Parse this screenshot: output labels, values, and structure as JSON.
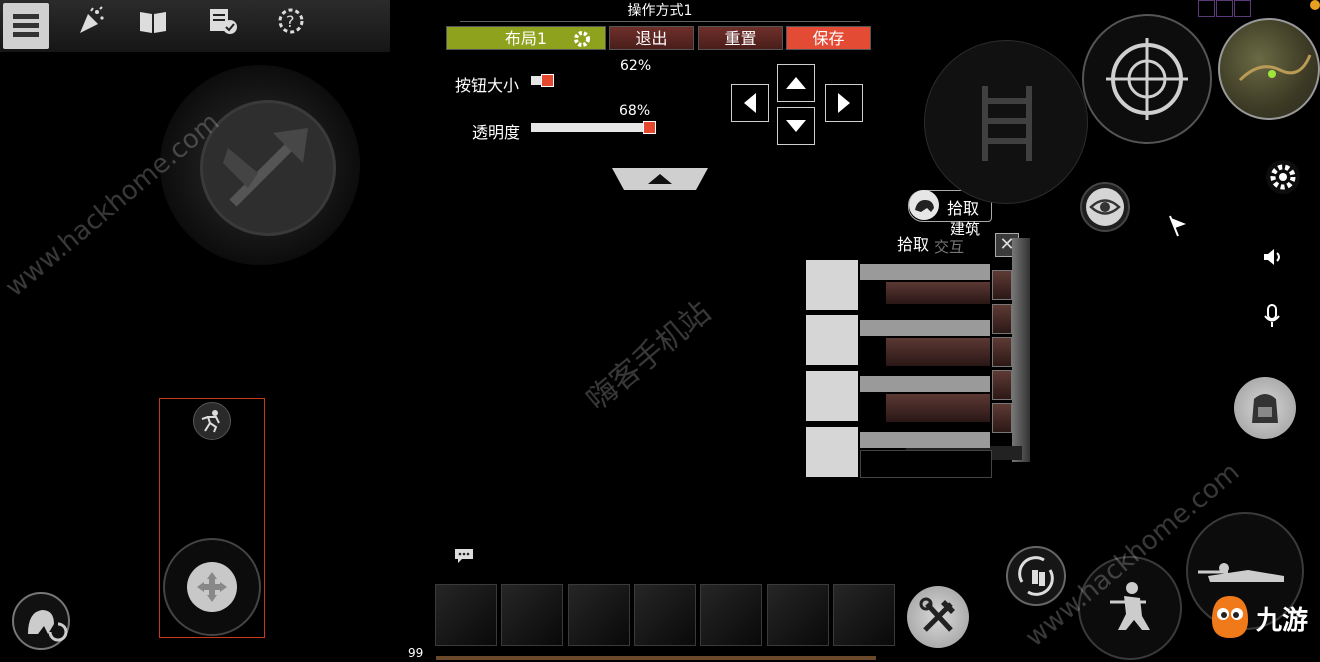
{
  "toolbar": {
    "icons": [
      "menu-icon",
      "party-popper-icon",
      "book-icon",
      "checklist-icon",
      "help-gear-icon"
    ]
  },
  "layout_editor": {
    "title": "操作方式1",
    "layout_label": "布局1",
    "exit_label": "退出",
    "reset_label": "重置",
    "save_label": "保存",
    "button_size_label": "按钮大小",
    "button_size_value": "62%",
    "button_size_fraction": 0.62,
    "opacity_label": "透明度",
    "opacity_value": "68%",
    "opacity_fraction": 0.68
  },
  "pickup": {
    "bubble_label": "拾取",
    "build_label": "建筑",
    "panel_title": "拾取",
    "interact_label": "交互",
    "close_label": "✕",
    "row_count": 4
  },
  "hotbar": {
    "slot_count": 7,
    "count_label": "99"
  },
  "watermarks": {
    "left": "www.hackhome.com",
    "center": "嗨客手机站",
    "right": "www.hackhome.com"
  },
  "brand": {
    "logo_text": "九游"
  },
  "colors": {
    "accent_green": "#8ea21e",
    "save_red": "#e34b35",
    "button_brown": "#5b2622",
    "joystick_frame": "#c8391c"
  }
}
